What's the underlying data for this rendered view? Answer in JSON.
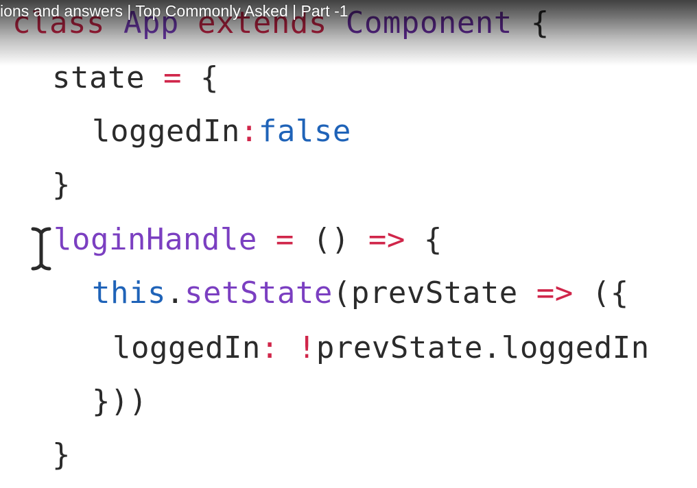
{
  "video": {
    "title": "ions and answers | Top Commonly Asked | Part -1"
  },
  "code": {
    "line1": {
      "kw_class": "class",
      "sp1": " ",
      "name": "App",
      "sp2": " ",
      "kw_extends": "extends",
      "sp3": " ",
      "parent": "Component",
      "tail": " {"
    },
    "line2": {
      "ident": "state",
      "sp": " ",
      "op": "=",
      "tail": " {"
    },
    "line3": {
      "ident": "loggedIn",
      "colon": ":",
      "value": "false"
    },
    "line4": {
      "text": "}"
    },
    "line5": {
      "ident": "loginHandle",
      "sp1": " ",
      "op": "=",
      "mid": " () ",
      "arrow": "=>",
      "tail": " {"
    },
    "line6": {
      "kw_this": "this",
      "dot": ".",
      "method": "setState",
      "mid": "(prevState ",
      "arrow": "=>",
      "tail": " ({"
    },
    "line7": {
      "ident": "loggedIn",
      "colon": ":",
      "sp": " ",
      "bang": "!",
      "tail": "prevState.loggedIn"
    },
    "line8": {
      "text": "}))"
    },
    "line9": {
      "text": "}"
    }
  },
  "colors": {
    "keyword_red": "#c2184b",
    "keyword_purple": "#7b3fc1",
    "keyword_blue": "#1f63b8",
    "operator": "#d0264a",
    "text": "#2b2b2b"
  },
  "icons": {
    "cursor": "text-cursor-icon"
  }
}
